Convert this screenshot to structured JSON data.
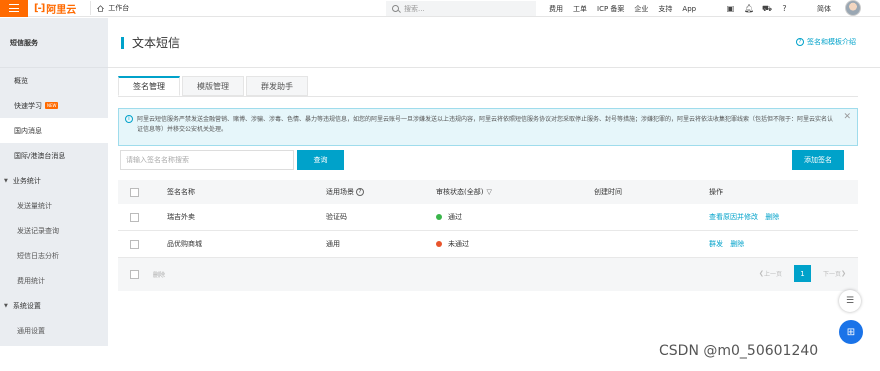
{
  "topbar": {
    "logo": "阿里云",
    "workspace": "工作台",
    "search_placeholder": "搜索...",
    "links": [
      "费用",
      "工单",
      "ICP 备案",
      "企业",
      "支持",
      "App"
    ],
    "language": "简体"
  },
  "sidebar": {
    "header": "短信服务",
    "items": [
      {
        "label": "概览"
      },
      {
        "label": "快速学习",
        "badge": "NEW"
      },
      {
        "label": "国内消息"
      },
      {
        "label": "国际/港澳台消息"
      }
    ],
    "group1": "业务统计",
    "group1_items": [
      "发送量统计",
      "发送记录查询",
      "短信日志分析",
      "费用统计"
    ],
    "group2": "系统设置",
    "group2_items": [
      "通用设置"
    ]
  },
  "main": {
    "title": "文本短信",
    "help_link": "签名和模板介绍",
    "tabs": [
      "签名管理",
      "模版管理",
      "群发助手"
    ],
    "notice": "阿里云短信服务严禁发送金融营销、赌博、涉骗、涉毒、色情、暴力等违规信息，如您的阿里云账号一旦涉嫌发送以上违规内容，阿里云将依照短信服务协议对您采取停止服务、封号等措施；涉嫌犯罪的，阿里云将依法收集犯罪线索（包括但不限于：阿里云实名认证信息等）并移交公安机关处理。",
    "search_placeholder": "请输入签名名称搜索",
    "query_button": "查询",
    "add_button": "添加签名",
    "table": {
      "headers": [
        "签名名称",
        "适用场景",
        "审核状态(全部)",
        "创建时间",
        "操作"
      ],
      "rows": [
        {
          "name": "瑞吉外卖",
          "scene": "验证码",
          "status": "通过",
          "status_color": "#3ab54a",
          "created": "",
          "actions": [
            "查看原因并修改",
            "删除"
          ]
        },
        {
          "name": "品优购商城",
          "scene": "通用",
          "status": "未通过",
          "status_color": "#e8542c",
          "created": "",
          "actions": [
            "群发",
            "删除"
          ]
        }
      ],
      "footer_delete": "删除",
      "pager_prev": "上一页",
      "pager_current": "1",
      "pager_next": "下一页"
    }
  },
  "watermark": "CSDN @m0_50601240",
  "colors": {
    "accent": "#00a2ca",
    "brand": "#ff6a00"
  }
}
